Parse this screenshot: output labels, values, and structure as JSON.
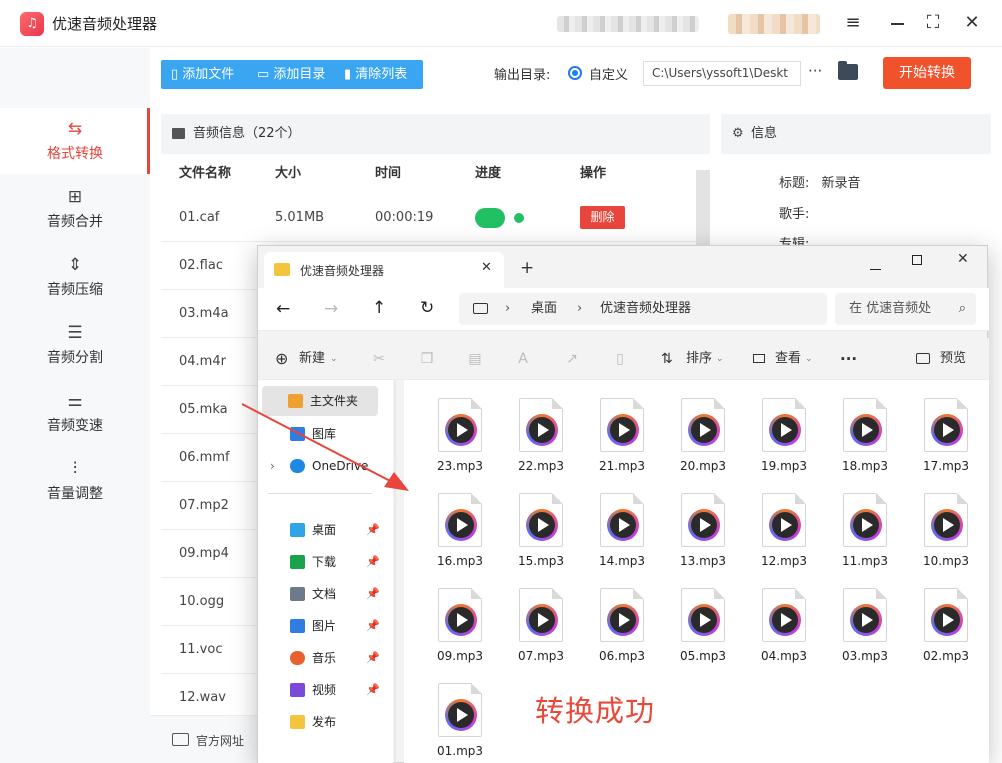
{
  "app": {
    "logo": "♫",
    "title": "优速音频处理器"
  },
  "window": {
    "menu_icon": "≡",
    "maximize_icon": "⛶",
    "close_icon": "✕"
  },
  "sidebar": {
    "items": [
      {
        "icon": "⇆",
        "label": "格式转换"
      },
      {
        "icon": "⊞",
        "label": "音频合并"
      },
      {
        "icon": "⇕",
        "label": "音频压缩"
      },
      {
        "icon": "☰",
        "label": "音频分割"
      },
      {
        "icon": "⚌",
        "label": "音频变速"
      },
      {
        "icon": "⫶",
        "label": "音量调整"
      }
    ]
  },
  "toolbar": {
    "add_file": "添加文件",
    "add_dir": "添加目录",
    "clear_list": "清除列表",
    "output_label": "输出目录:",
    "output_option": "自定义",
    "output_path": "C:\\Users\\yssoft1\\Deskt",
    "more": "···",
    "start": "开始转换"
  },
  "list": {
    "header": "音频信息（22个）",
    "columns": {
      "name": "文件名称",
      "size": "大小",
      "time": "时间",
      "progress": "进度",
      "action": "操作"
    },
    "rows": [
      {
        "name": "01.caf",
        "size": "5.01MB",
        "time": "00:00:19",
        "action": "删除"
      },
      {
        "name": "02.flac"
      },
      {
        "name": "03.m4a"
      },
      {
        "name": "04.m4r"
      },
      {
        "name": "05.mka"
      },
      {
        "name": "06.mmf"
      },
      {
        "name": "07.mp2"
      },
      {
        "name": "09.mp4"
      },
      {
        "name": "10.ogg"
      },
      {
        "name": "11.voc"
      },
      {
        "name": "12.wav"
      }
    ]
  },
  "info": {
    "header": "信息",
    "title_label": "标题:",
    "title_value": "新录音",
    "artist_label": "歌手:",
    "album_label": "专辑:"
  },
  "footer": {
    "website": "官方网址"
  },
  "explorer": {
    "tab_title": "优速音频处理器",
    "new_tab": "+",
    "address": {
      "desktop": "桌面",
      "folder": "优速音频处理器"
    },
    "search_placeholder": "在 优速音频处",
    "cmd": {
      "new": "新建",
      "sort": "排序",
      "view": "查看",
      "more": "···",
      "preview": "预览"
    },
    "nav": [
      {
        "label": "主文件夹",
        "color": "#f0a030"
      },
      {
        "label": "图库",
        "color": "#2f7de1"
      },
      {
        "label": "OneDrive",
        "color": "#1e88e5"
      },
      {
        "label": "桌面",
        "color": "#2fa4e7"
      },
      {
        "label": "下载",
        "color": "#1aa34a"
      },
      {
        "label": "文档",
        "color": "#6b7b8c"
      },
      {
        "label": "图片",
        "color": "#2f7de1"
      },
      {
        "label": "音乐",
        "color": "#e9602f"
      },
      {
        "label": "视频",
        "color": "#7b4ad9"
      },
      {
        "label": "发布",
        "color": "#f3c43d"
      }
    ],
    "files": [
      "23.mp3",
      "22.mp3",
      "21.mp3",
      "20.mp3",
      "19.mp3",
      "18.mp3",
      "17.mp3",
      "16.mp3",
      "15.mp3",
      "14.mp3",
      "13.mp3",
      "12.mp3",
      "11.mp3",
      "10.mp3",
      "09.mp3",
      "07.mp3",
      "06.mp3",
      "05.mp3",
      "04.mp3",
      "03.mp3",
      "02.mp3",
      "01.mp3"
    ]
  },
  "annotation": {
    "success_text": "转换成功",
    "arrow_color": "#e8453c"
  },
  "colors": {
    "accent": "#e8453c",
    "blue": "#3aa6f2",
    "start": "#f0522b",
    "progress": "#21c063"
  }
}
